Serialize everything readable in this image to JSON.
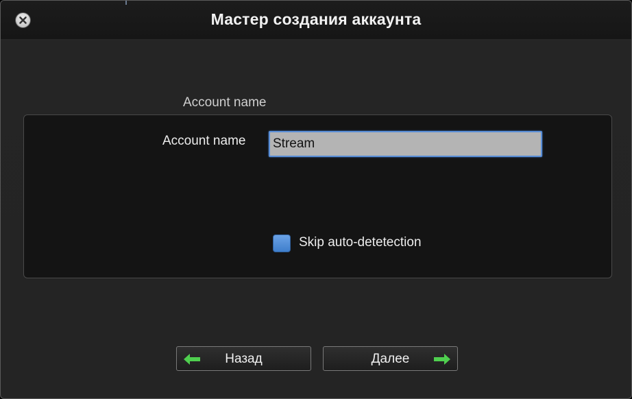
{
  "window": {
    "title": "Мастер создания аккаунта"
  },
  "group": {
    "title": "Account name",
    "field_label": "Account name",
    "field_value": "Stream",
    "checkbox_label": "Skip auto-detetection"
  },
  "buttons": {
    "back_label": "Назад",
    "next_label": "Далее"
  },
  "colors": {
    "accent": "#5a8fd8",
    "arrow": "#4fcf4f",
    "window_bg": "#242424",
    "panel_bg": "#141414"
  },
  "icons": {
    "close": "close-icon",
    "back": "arrow-left-icon",
    "next": "arrow-right-icon"
  }
}
